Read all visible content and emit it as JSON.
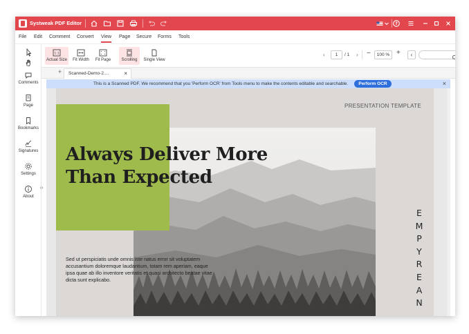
{
  "app": {
    "title": "Systweak PDF Editor"
  },
  "colors": {
    "brand": "#e3474e",
    "notice_bg": "#ccdefa",
    "ocr_button": "#2f6fdc",
    "highlight_green": "#9fbb4c"
  },
  "titlebar": {
    "icons": [
      "home-icon",
      "folder-icon",
      "save-icon",
      "print-icon",
      "undo-icon",
      "redo-icon"
    ],
    "right_icons": [
      "flag-icon",
      "chevron-down-icon",
      "help-icon",
      "menu-icon",
      "minimize-icon",
      "maximize-icon",
      "close-icon"
    ]
  },
  "menu": {
    "items": [
      "File",
      "Edit",
      "Comment",
      "Convert",
      "View",
      "Page",
      "Secure",
      "Forms",
      "Tools"
    ],
    "active": "View"
  },
  "sidebar": {
    "items": [
      {
        "label": "Comments",
        "icon": "comment-icon"
      },
      {
        "label": "Page",
        "icon": "page-icon"
      },
      {
        "label": "Bookmarks",
        "icon": "bookmark-icon"
      },
      {
        "label": "Signatures",
        "icon": "signature-icon"
      },
      {
        "label": "Settings",
        "icon": "gear-icon"
      },
      {
        "label": "About",
        "icon": "info-icon"
      }
    ]
  },
  "toolbar": {
    "tools": [
      {
        "label": "Actual Size",
        "icon": "actual-size-icon",
        "selected": true
      },
      {
        "label": "Fit Width",
        "icon": "fit-width-icon",
        "selected": false
      },
      {
        "label": "Fit Page",
        "icon": "fit-page-icon",
        "selected": false
      },
      {
        "label": "Scrolling",
        "icon": "scrolling-icon",
        "selected": true
      },
      {
        "label": "Single View",
        "icon": "single-view-icon",
        "selected": false
      }
    ],
    "page_current": "1",
    "page_total": "/ 1",
    "zoom": "100 %",
    "search_value": ""
  },
  "tabs": {
    "items": [
      {
        "label": "Scanned-Demo-2...."
      }
    ]
  },
  "notice": {
    "text": "This is a Scanned PDF. We recommend that you 'Perform OCR' from Tools menu to make the contents editable and searchable.",
    "button": "Perform OCR"
  },
  "document": {
    "template_label": "PRESENTATION TEMPLATE",
    "headline_line1": "Always Deliver More",
    "headline_line2": "Than Expected",
    "paragraph": "Sed ut perspiciatis unde omnis iste natus error sit voluptatem accusantium doloremque laudantium, totam rem aperiam, eaque ipsa quae ab illo inventore veritatis et quasi architecto beatae vitae dicta sunt explicabo.",
    "vertical_word": [
      "E",
      "M",
      "P",
      "Y",
      "R",
      "E",
      "A",
      "N"
    ]
  }
}
